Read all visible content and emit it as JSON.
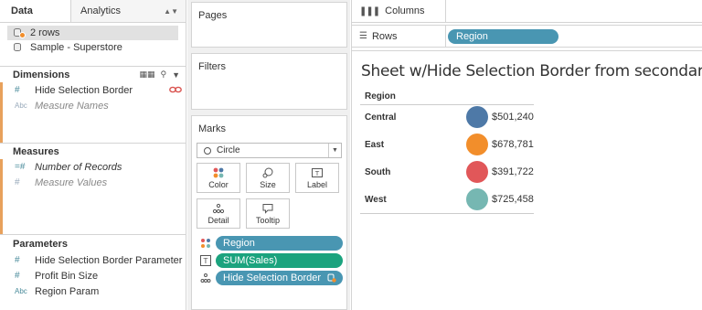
{
  "data_pane": {
    "tabs": [
      "Data",
      "Analytics"
    ],
    "datasources": [
      "2 rows",
      "Sample - Superstore"
    ],
    "dimensions_title": "Dimensions",
    "dimensions": [
      {
        "type": "#",
        "name": "Hide Selection Border"
      },
      {
        "type": "Abc",
        "name": "Measure Names"
      }
    ],
    "measures_title": "Measures",
    "measures": [
      {
        "type": "=#",
        "name": "Number of Records"
      },
      {
        "type": "#",
        "name": "Measure Values"
      }
    ],
    "parameters_title": "Parameters",
    "parameters": [
      {
        "type": "#",
        "name": "Hide Selection Border Parameter"
      },
      {
        "type": "#",
        "name": "Profit Bin Size"
      },
      {
        "type": "Abc",
        "name": "Region Param"
      }
    ]
  },
  "shelves": {
    "pages": "Pages",
    "filters": "Filters",
    "marks": "Marks",
    "mark_type": "Circle",
    "mark_buttons": [
      "Color",
      "Size",
      "Label",
      "Detail",
      "Tooltip"
    ],
    "mark_pills": [
      "Region",
      "SUM(Sales)",
      "Hide Selection Border"
    ],
    "columns": "Columns",
    "rows": "Rows",
    "rows_pill": "Region"
  },
  "view": {
    "title": "Sheet w/Hide Selection Border from secondary",
    "column_header": "Region",
    "rows": [
      {
        "region": "Central",
        "value": "$501,240",
        "color": "#4e79a7"
      },
      {
        "region": "East",
        "value": "$678,781",
        "color": "#f28e2b"
      },
      {
        "region": "South",
        "value": "$391,722",
        "color": "#e15759"
      },
      {
        "region": "West",
        "value": "$725,458",
        "color": "#76b7b2"
      }
    ]
  },
  "colors": {
    "pill_blue": "#4996b2",
    "pill_green": "#1ba37e",
    "dimension_accent": "#e8a15c",
    "link_red": "#d9534f"
  }
}
